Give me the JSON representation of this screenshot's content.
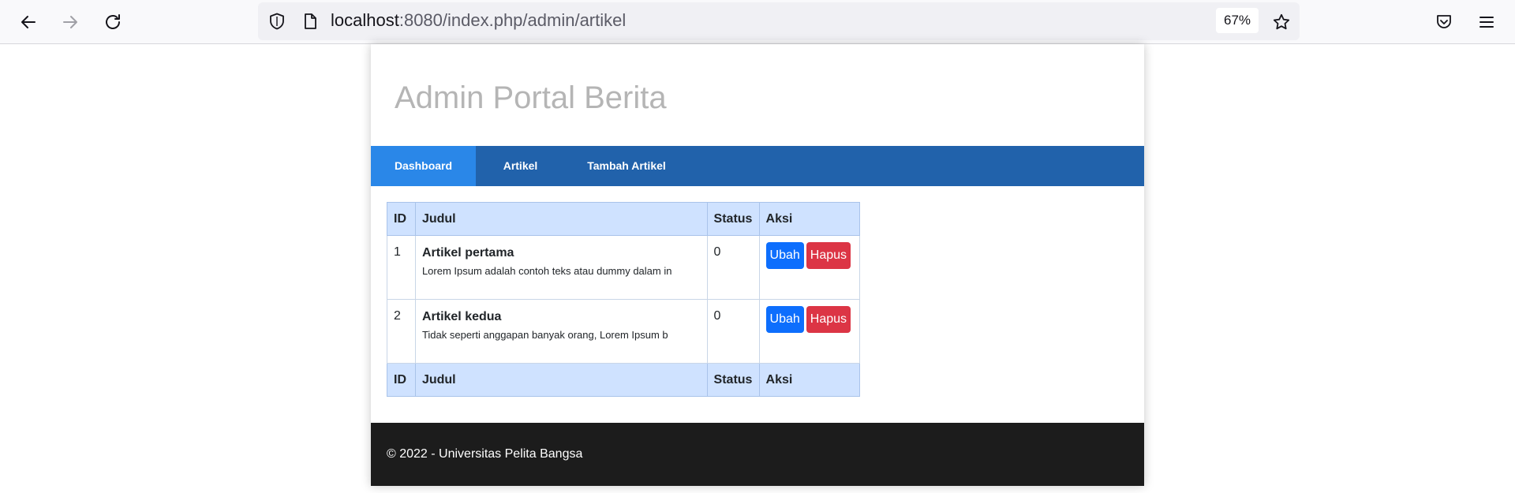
{
  "browser": {
    "url_host": "localhost",
    "url_rest": ":8080/index.php/admin/artikel",
    "zoom": "67%",
    "icons": {
      "back": "back-arrow-icon",
      "forward": "forward-arrow-icon",
      "reload": "reload-icon",
      "shield": "tracking-protection-shield-icon",
      "page": "page-info-icon",
      "star": "bookmark-star-icon",
      "pocket": "pocket-icon",
      "menu": "hamburger-menu-icon"
    }
  },
  "header": {
    "title": "Admin Portal Berita"
  },
  "nav": {
    "items": [
      {
        "label": "Dashboard",
        "active": true
      },
      {
        "label": "Artikel",
        "active": false
      },
      {
        "label": "Tambah Artikel",
        "active": false
      }
    ]
  },
  "table": {
    "columns": [
      "ID",
      "Judul",
      "Status",
      "Aksi"
    ],
    "rows": [
      {
        "id": "1",
        "title": "Artikel pertama",
        "snippet": "Lorem Ipsum adalah contoh teks atau dummy dalam in",
        "status": "0",
        "edit": "Ubah",
        "delete": "Hapus"
      },
      {
        "id": "2",
        "title": "Artikel kedua",
        "snippet": "Tidak seperti anggapan banyak orang, Lorem Ipsum b",
        "status": "0",
        "edit": "Ubah",
        "delete": "Hapus"
      }
    ]
  },
  "footer": {
    "text": "© 2022 - Universitas Pelita Bangsa"
  },
  "colors": {
    "navbar": "#2162ab",
    "nav_active": "#2a87e8",
    "table_header": "#cfe2ff",
    "edit_button": "#0d6efd",
    "delete_button": "#dc3545",
    "footer": "#1c1c1c"
  }
}
